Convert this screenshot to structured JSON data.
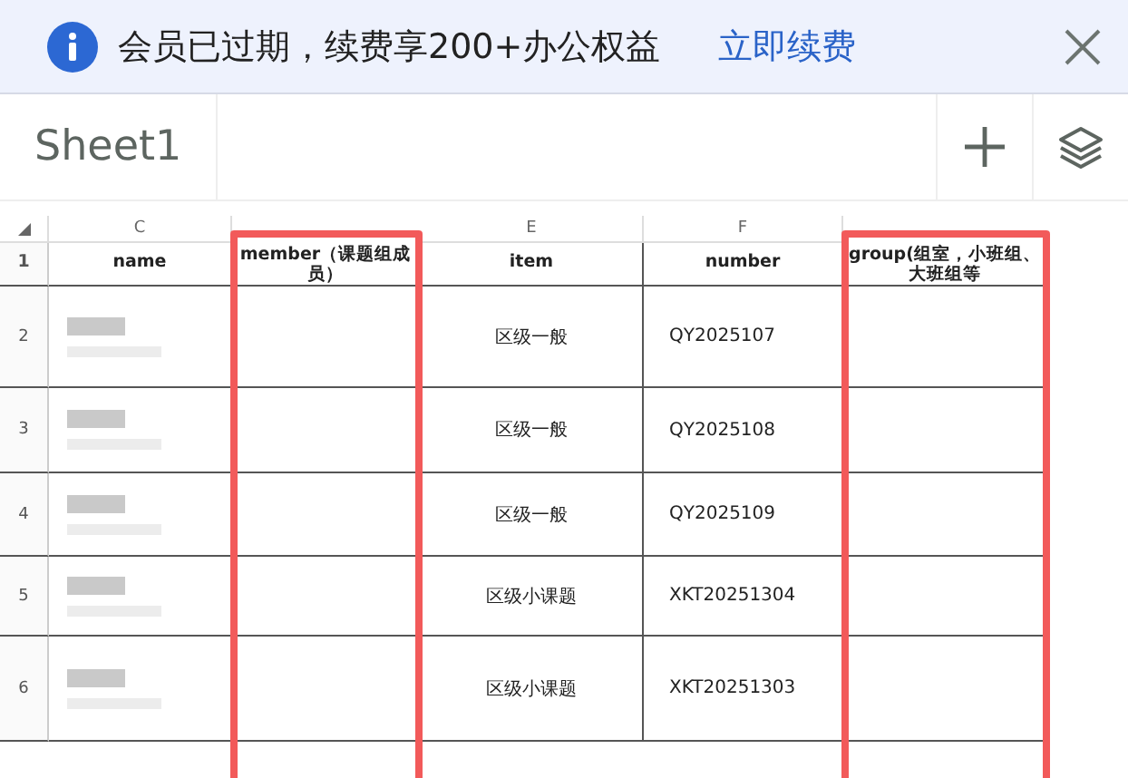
{
  "banner": {
    "message": "会员已过期，续费享200+办公权益",
    "link": "立即续费"
  },
  "sheet_tabs": [
    {
      "label": "Sheet1",
      "selected": true
    }
  ],
  "columns": [
    {
      "letter": "C",
      "header": "name",
      "highlighted": false
    },
    {
      "header": "member（课题组成员）",
      "highlighted": true
    },
    {
      "letter": "E",
      "header": "item",
      "highlighted": false
    },
    {
      "letter": "F",
      "header": "number",
      "highlighted": false
    },
    {
      "header": "group(组室，小班组、大班组等",
      "highlighted": true
    }
  ],
  "header_row_label": "1",
  "rows": [
    {
      "row_label": "2",
      "item": "区级一般",
      "number": "QY2025107"
    },
    {
      "row_label": "3",
      "item": "区级一般",
      "number": "QY2025108"
    },
    {
      "row_label": "4",
      "item": "区级一般",
      "number": "QY2025109"
    },
    {
      "row_label": "5",
      "item": "区级小课题",
      "number": "XKT20251304"
    },
    {
      "row_label": "6",
      "item": "区级小课题",
      "number": "XKT20251303"
    }
  ]
}
